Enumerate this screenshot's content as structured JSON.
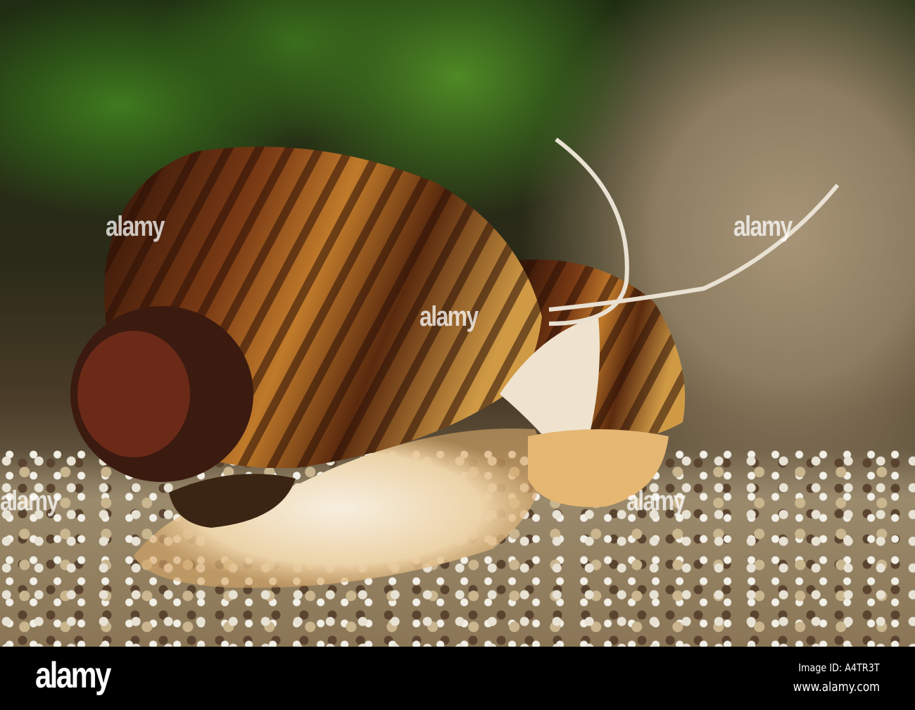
{
  "photo": {
    "subject": "snail",
    "colors": {
      "shell_dark": "#3a1a0c",
      "shell_light": "#c98a35",
      "body": "#f1e6d0"
    }
  },
  "watermark": {
    "text": "alamy"
  },
  "footer": {
    "logo": "alamy",
    "image_id": "Image ID: A4TR3T",
    "url": "www.alamy.com"
  }
}
